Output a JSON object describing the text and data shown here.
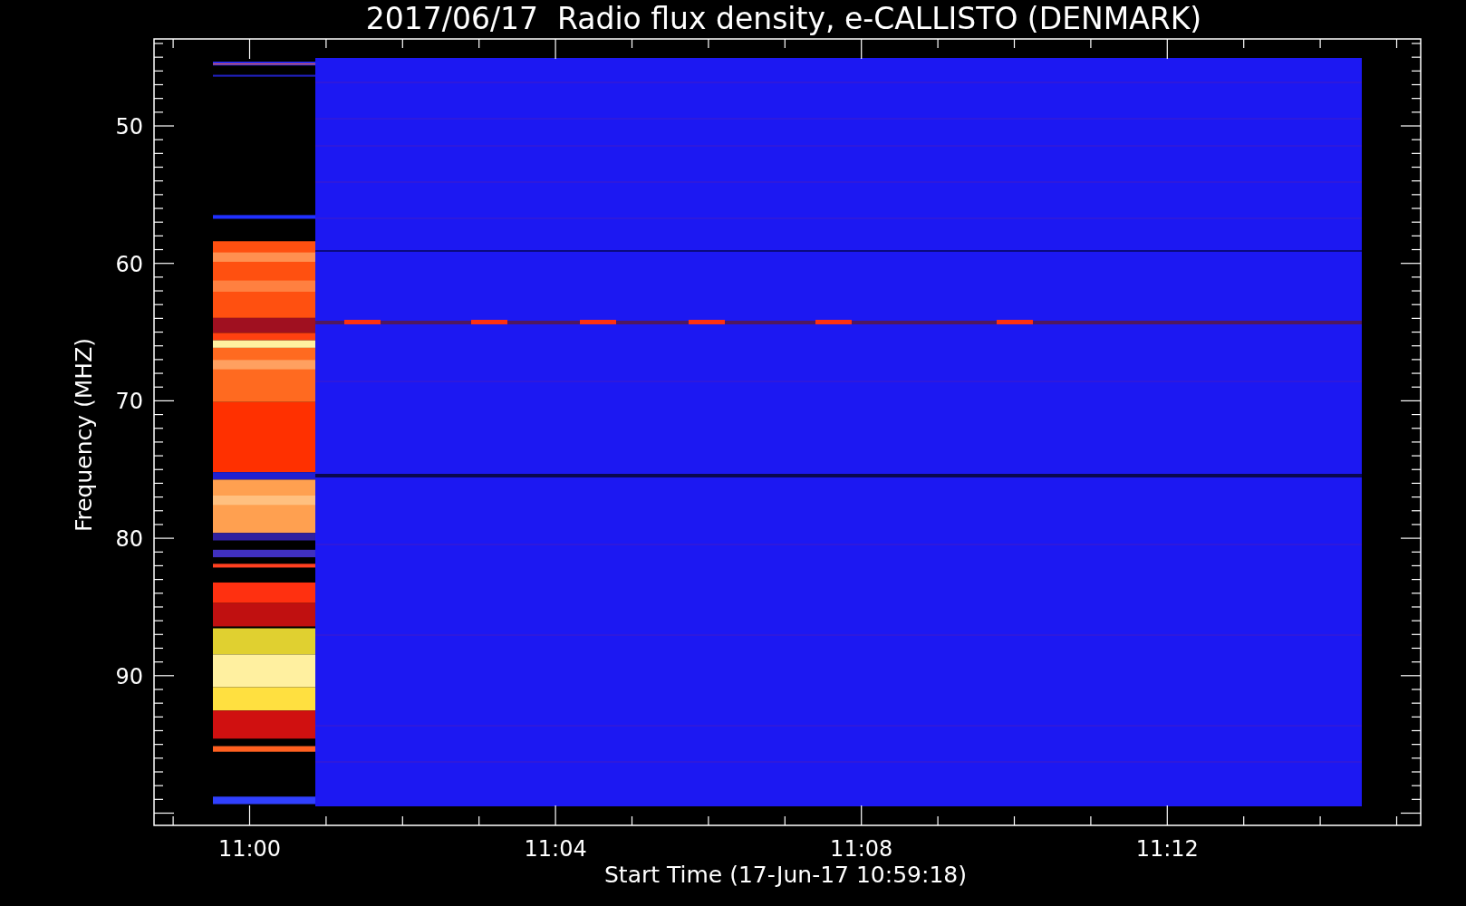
{
  "title": "2017/06/17  Radio flux density, e-CALLISTO (DENMARK)",
  "y_axis": {
    "label": "Frequency (MHZ)",
    "ticks": [
      "50",
      "60",
      "70",
      "80",
      "90"
    ]
  },
  "x_axis": {
    "label": "Start Time (17-Jun-17 10:59:18)",
    "ticks": [
      "11:00",
      "11:04",
      "11:08",
      "11:12"
    ]
  }
}
